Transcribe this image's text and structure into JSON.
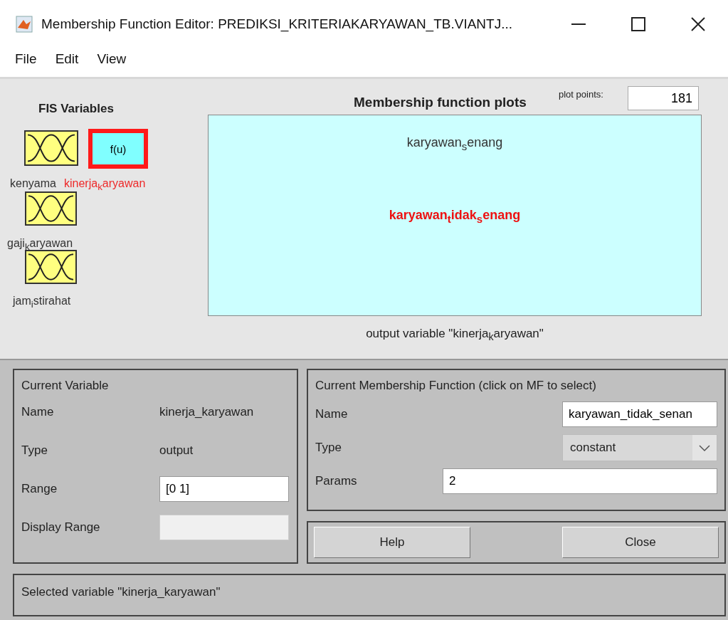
{
  "window": {
    "title": "Membership Function Editor: PREDIKSI_KRITERIAKARYAWAN_TB.VIANTJ..."
  },
  "menu": [
    "File",
    "Edit",
    "View"
  ],
  "fis_variables": {
    "title": "FIS Variables",
    "items": [
      {
        "kind": "input",
        "label": "kenyama",
        "selected": false
      },
      {
        "kind": "output",
        "box": "f(u)",
        "label": "kinerja$_{k}$aryawan",
        "selected": true
      },
      {
        "kind": "input",
        "label": "gaji$_{k}$aryawan",
        "selected": false
      },
      {
        "kind": "input",
        "label": "jam$_{i}$stirahat",
        "selected": false
      }
    ]
  },
  "plot": {
    "title": "Membership function plots",
    "plot_points_label": "plot points:",
    "plot_points": "181",
    "mfs": [
      {
        "label": "karyawan$_{s}$enang",
        "selected": false
      },
      {
        "label": "karyawan$_{t}$idak$_{s}$enang",
        "selected": true
      }
    ],
    "caption": "output variable \"kinerja$_{k}$aryawan\""
  },
  "current_variable": {
    "title": "Current Variable",
    "rows": [
      {
        "kind": "text",
        "label": "Name",
        "value": "kinerja_karyawan"
      },
      {
        "kind": "text",
        "label": "Type",
        "value": "output"
      },
      {
        "kind": "field",
        "label": "Range",
        "value": "[0 1]"
      },
      {
        "kind": "disabled_field",
        "label": "Display Range"
      }
    ]
  },
  "current_mf": {
    "title": "Current Membership Function (click on MF to select)",
    "name_label": "Name",
    "name": "karyawan_tidak_senan",
    "type_label": "Type",
    "type": "constant",
    "params_label": "Params",
    "params": "2"
  },
  "buttons": [
    "Help",
    "Close"
  ],
  "status": "Selected variable \"kinerja_karyawan\""
}
